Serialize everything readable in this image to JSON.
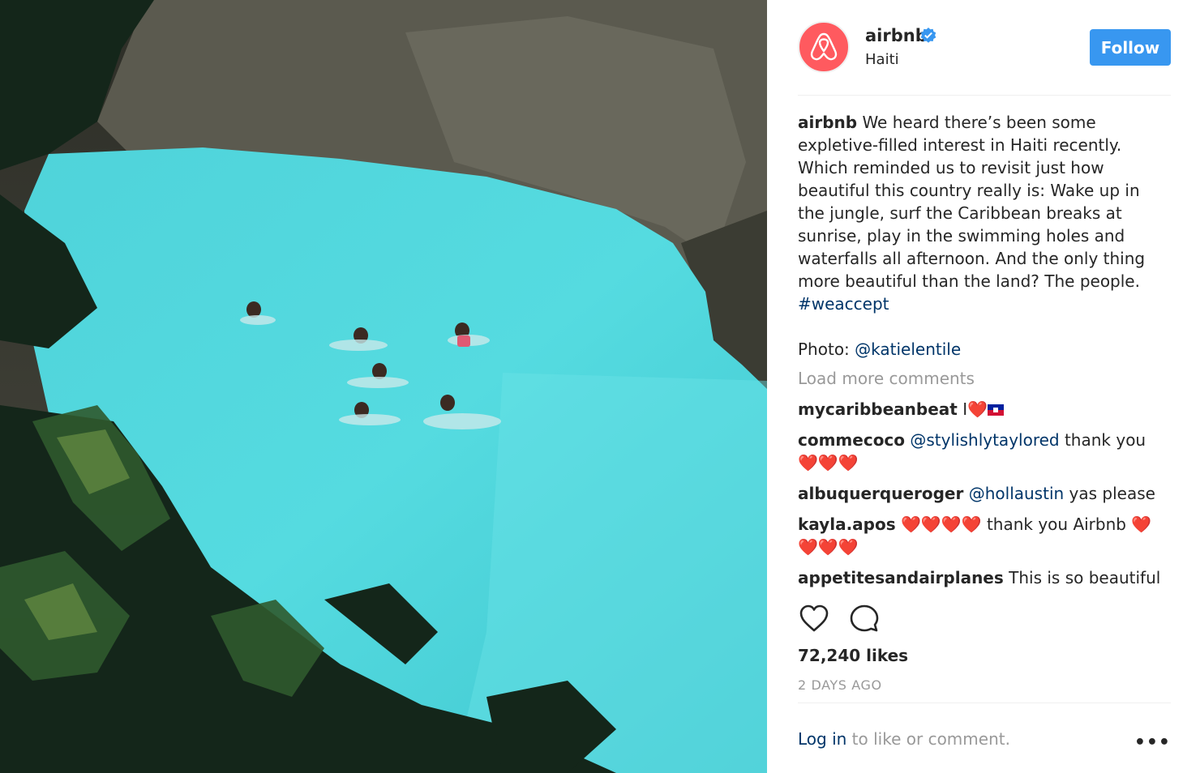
{
  "post": {
    "photo": {
      "alt_icon": "photo-image"
    },
    "header": {
      "username": "airbnb",
      "verified_icon": "verified-badge-icon",
      "location": "Haiti",
      "follow_label": "Follow",
      "brand_color": "#ff5a5f",
      "button_color": "#3897f0"
    },
    "caption": {
      "username": "airbnb",
      "text": "We heard there’s been some expletive-filled interest in Haiti recently. Which reminded us to revisit just how beautiful this country really is: Wake up in the jungle, surf the Caribbean breaks at sunrise, play in the swimming holes and waterfalls all afternoon. And the only thing more beautiful than the land? The people.",
      "hashtag": "#weaccept"
    },
    "credit": {
      "prefix": "Photo:",
      "handle": "@katielentile"
    },
    "load_more": "Load more comments",
    "comments": [
      {
        "username": "mycaribbeanbeat",
        "text": "I",
        "hearts": "❤️",
        "flag_icon": "haiti-flag-icon"
      },
      {
        "username": "commecoco",
        "mention": "@stylishlytaylored",
        "text": "thank you",
        "hearts": "❤️❤️❤️"
      },
      {
        "username": "albuquerqueroger",
        "mention": "@hollaustin",
        "text": "yas please"
      },
      {
        "username": "kayla.apos",
        "hearts_before": "❤️❤️❤️❤️",
        "text": "thank you Airbnb",
        "hearts": "❤️❤️❤️❤️"
      },
      {
        "username": "appetitesandairplanes",
        "text": "This is so beautiful"
      }
    ],
    "actions": {
      "like_icon": "heart-outline-icon",
      "comment_icon": "comment-bubble-icon"
    },
    "likes": "72,240 likes",
    "timestamp": "2 DAYS AGO",
    "footer": {
      "login_label": "Log in",
      "login_suffix": "to like or comment.",
      "more_label": "•••"
    }
  }
}
